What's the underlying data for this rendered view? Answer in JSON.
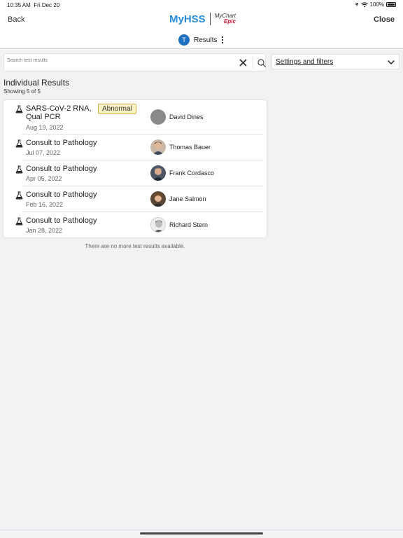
{
  "status": {
    "time": "10:35 AM",
    "date": "Fri Dec 20",
    "battery": "100%"
  },
  "nav": {
    "back_label": "Back",
    "close_label": "Close",
    "logo_main": "MyHSS",
    "logo_sub": "MyChart",
    "logo_by": "Epic"
  },
  "context": {
    "avatar_letter": "T",
    "label": "Results",
    "menu_icon": "kebab-icon"
  },
  "search": {
    "placeholder": "Search test results",
    "value": ""
  },
  "filters": {
    "label": "Settings and filters"
  },
  "section": {
    "title": "Individual Results",
    "subtitle": "Showing 5 of 5"
  },
  "results": [
    {
      "name_line1": "SARS-CoV-2 RNA,",
      "name_line2": "Qual PCR",
      "date": "Aug 19, 2022",
      "badge": "Abnormal",
      "provider": "David Dines"
    },
    {
      "name_line1": "Consult to Pathology",
      "date": "Jul 07, 2022",
      "provider": "Thomas Bauer"
    },
    {
      "name_line1": "Consult to Pathology",
      "date": "Apr 05, 2022",
      "provider": "Frank Cordasco"
    },
    {
      "name_line1": "Consult to Pathology",
      "date": "Feb 16, 2022",
      "provider": "Jane Salmon"
    },
    {
      "name_line1": "Consult to Pathology",
      "date": "Jan 28, 2022",
      "provider": "Richard Stern"
    }
  ],
  "footer": {
    "no_more": "There are no more test results available."
  },
  "colors": {
    "brand_blue": "#2a8dd8",
    "avatar_blue": "#1d6fbf",
    "epic_red": "#c8102e",
    "badge_bg": "#fdf3c4",
    "badge_border": "#d4b24a"
  }
}
